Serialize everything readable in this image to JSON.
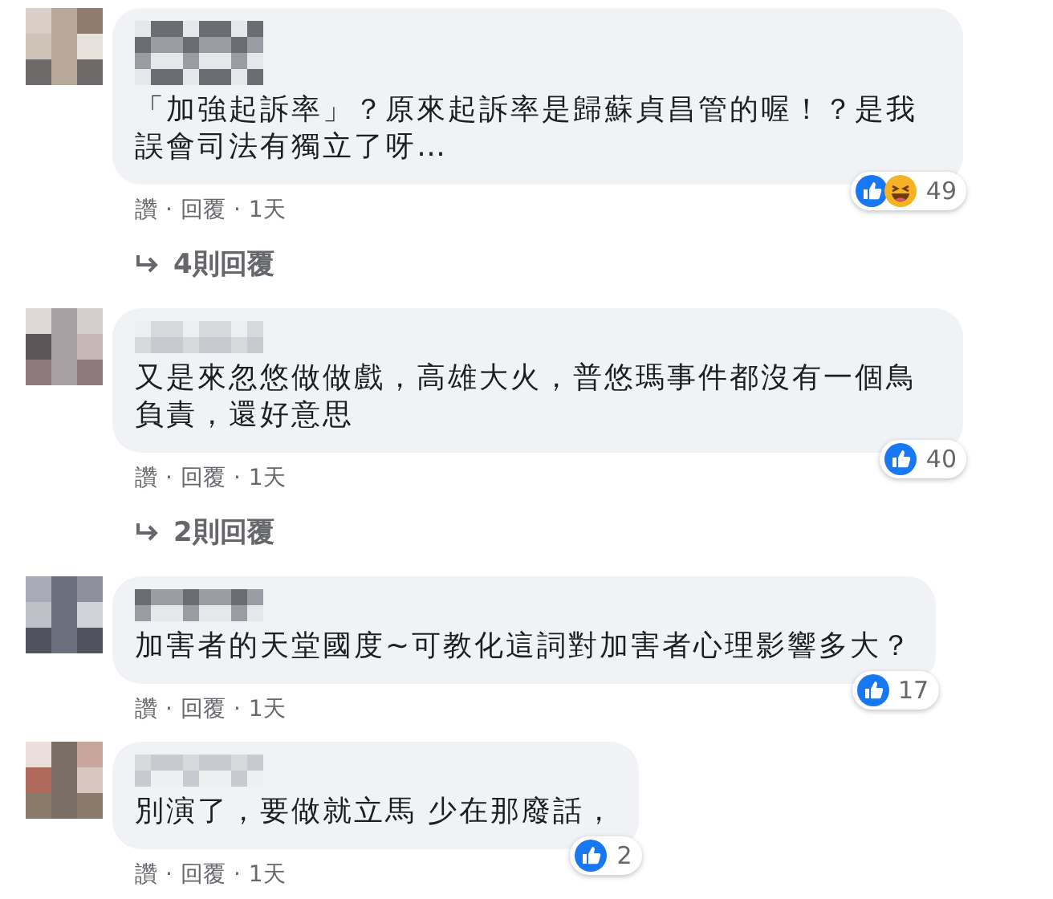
{
  "separator": "·",
  "comments": [
    {
      "text": "「加強起訴率」？原來起訴率是歸蘇貞昌管的喔！？是我誤會司法有獨立了呀…",
      "reactions": [
        {
          "kind": "like"
        },
        {
          "kind": "haha"
        }
      ],
      "reaction_count": "49",
      "actions": {
        "like": "讚",
        "reply": "回覆",
        "time": "1天"
      },
      "replies": "4則回覆"
    },
    {
      "text": "又是來忽悠做做戲，高雄大火，普悠瑪事件都沒有一個鳥負責，還好意思",
      "reactions": [
        {
          "kind": "like"
        }
      ],
      "reaction_count": "40",
      "actions": {
        "like": "讚",
        "reply": "回覆",
        "time": "1天"
      },
      "replies": "2則回覆"
    },
    {
      "text": "加害者的天堂國度~可教化這詞對加害者心理影響多大？",
      "reactions": [
        {
          "kind": "like"
        }
      ],
      "reaction_count": "17",
      "actions": {
        "like": "讚",
        "reply": "回覆",
        "time": "1天"
      }
    },
    {
      "text": "別演了，要做就立馬 少在那廢話，",
      "reactions": [
        {
          "kind": "like"
        }
      ],
      "reaction_count": "2",
      "actions": {
        "like": "讚",
        "reply": "回覆",
        "time": "1天"
      }
    }
  ]
}
